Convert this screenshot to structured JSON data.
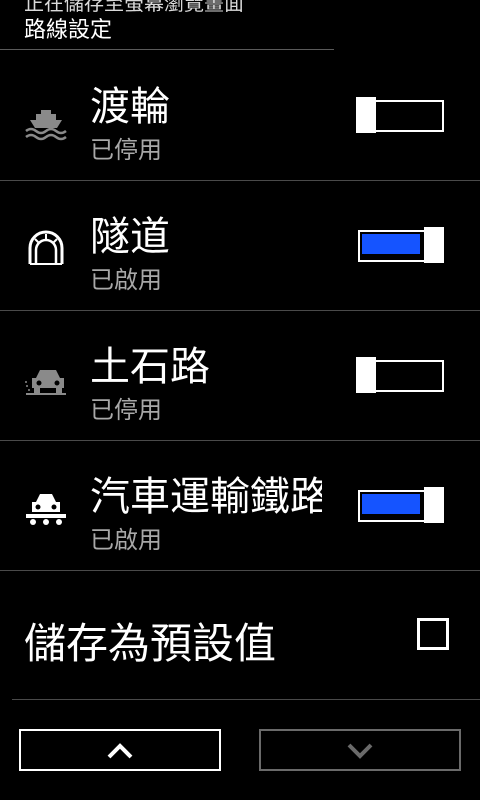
{
  "header": {
    "subtitle": "正在儲存至螢幕瀏覽畫面",
    "title": "路線設定"
  },
  "rows": [
    {
      "title": "渡輪",
      "status": "已停用",
      "icon": "ferry-icon",
      "enabled": false
    },
    {
      "title": "隧道",
      "status": "已啟用",
      "icon": "tunnel-icon",
      "enabled": true
    },
    {
      "title": "土石路",
      "status": "已停用",
      "icon": "dirt-road-icon",
      "enabled": false
    },
    {
      "title": "汽車運輸鐵路",
      "status": "已啟用",
      "icon": "car-train-icon",
      "enabled": true
    }
  ],
  "save_default": {
    "label": "儲存為預設值",
    "checked": false
  },
  "nav": {
    "up_icon": "chevron-up-icon",
    "down_icon": "chevron-down-icon",
    "down_disabled": true
  },
  "colors": {
    "toggle_on": "#1554ff",
    "status_text": "#a8a8a8",
    "divider": "#4a4a4a"
  }
}
